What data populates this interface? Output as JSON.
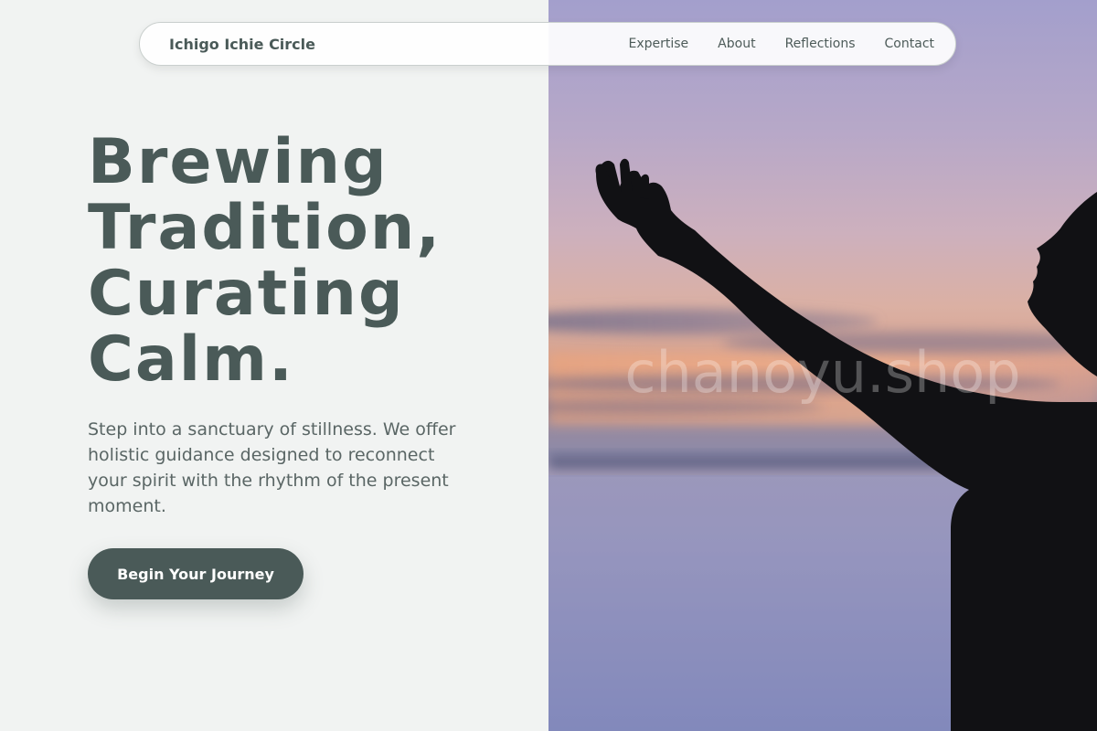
{
  "nav": {
    "brand": "Ichigo Ichie Circle",
    "links": [
      "Expertise",
      "About",
      "Reflections",
      "Contact"
    ]
  },
  "hero": {
    "title_lines": [
      "Brewing",
      "Tradition,",
      "Curating",
      "Calm."
    ],
    "subtitle": "Step into a sanctuary of stillness. We offer holistic guidance designed to reconnect your spirit with the rhythm of the present moment.",
    "cta_label": "Begin Your Journey",
    "image_watermark": "chanoyu.shop"
  },
  "colors": {
    "primary": "#4a5a58",
    "background": "#f1f3f2"
  }
}
